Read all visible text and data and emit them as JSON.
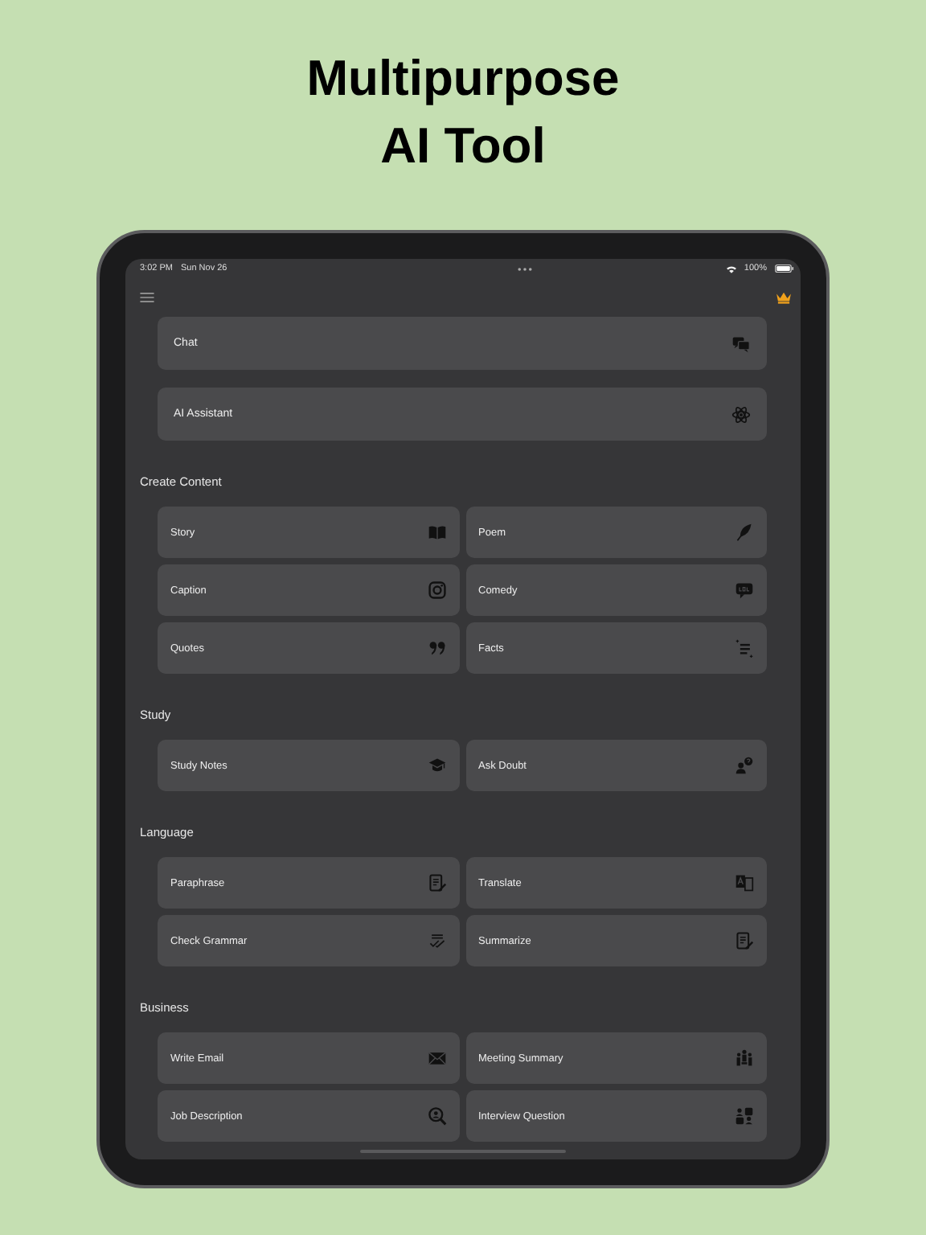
{
  "headline": [
    "Multipurpose",
    "AI Tool"
  ],
  "status_bar": {
    "time": "3:02 PM",
    "date": "Sun Nov 26",
    "battery": "100%"
  },
  "top_items": [
    {
      "label": "Chat"
    },
    {
      "label": "AI Assistant"
    }
  ],
  "sections": [
    {
      "title": "Create Content",
      "items": [
        {
          "label": "Story"
        },
        {
          "label": "Poem"
        },
        {
          "label": "Caption"
        },
        {
          "label": "Comedy"
        },
        {
          "label": "Quotes"
        },
        {
          "label": "Facts"
        }
      ]
    },
    {
      "title": "Study",
      "items": [
        {
          "label": "Study Notes"
        },
        {
          "label": "Ask Doubt"
        }
      ]
    },
    {
      "title": "Language",
      "items": [
        {
          "label": "Paraphrase"
        },
        {
          "label": "Translate"
        },
        {
          "label": "Check Grammar"
        },
        {
          "label": "Summarize"
        }
      ]
    },
    {
      "title": "Business",
      "items": [
        {
          "label": "Write Email"
        },
        {
          "label": "Meeting Summary"
        },
        {
          "label": "Job Description"
        },
        {
          "label": "Interview Question"
        }
      ]
    }
  ]
}
